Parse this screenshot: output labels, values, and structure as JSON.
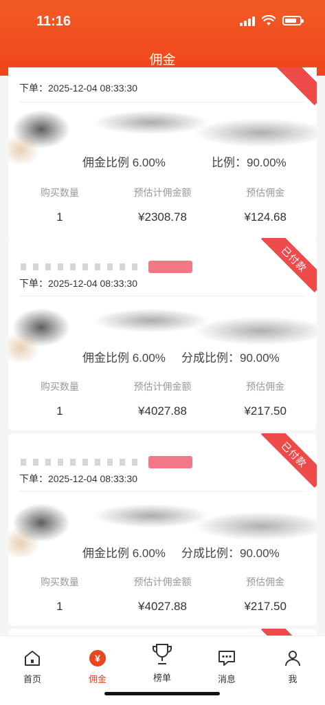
{
  "status_bar": {
    "time": "11:16"
  },
  "header": {
    "title": "佣金"
  },
  "orders": [
    {
      "badge": "",
      "order_time": "下单：2025-12-04 08:33:30",
      "commission_ratio": "佣金比例 6.00%",
      "share_ratio": "比例：90.00%",
      "stats": [
        {
          "label": "购买数量",
          "value": "1"
        },
        {
          "label": "预估计佣金额",
          "value": "¥2308.78"
        },
        {
          "label": "预估佣金",
          "value": "¥124.68"
        }
      ]
    },
    {
      "badge": "已付款",
      "order_time": "下单：2025-12-04 08:33:30",
      "commission_ratio": "佣金比例 6.00%",
      "share_ratio": "分成比例：90.00%",
      "stats": [
        {
          "label": "购买数量",
          "value": "1"
        },
        {
          "label": "预估计佣金额",
          "value": "¥4027.88"
        },
        {
          "label": "预估佣金",
          "value": "¥217.50"
        }
      ]
    },
    {
      "badge": "已付款",
      "order_time": "下单：2025-12-04 08:33:30",
      "commission_ratio": "佣金比例 6.00%",
      "share_ratio": "分成比例：90.00%",
      "stats": [
        {
          "label": "购买数量",
          "value": "1"
        },
        {
          "label": "预估计佣金额",
          "value": "¥4027.88"
        },
        {
          "label": "预估佣金",
          "value": "¥217.50"
        }
      ]
    }
  ],
  "tabbar": {
    "items": [
      {
        "label": "首页",
        "icon": "home-icon"
      },
      {
        "label": "佣金",
        "icon": "yen-icon",
        "active": true
      },
      {
        "label": "榜单",
        "icon": "trophy-icon"
      },
      {
        "label": "消息",
        "icon": "message-icon"
      },
      {
        "label": "我",
        "icon": "user-icon"
      }
    ]
  },
  "colors": {
    "accent": "#f0451c",
    "badge": "#ef4a4a",
    "active_tab": "#e8461f"
  }
}
